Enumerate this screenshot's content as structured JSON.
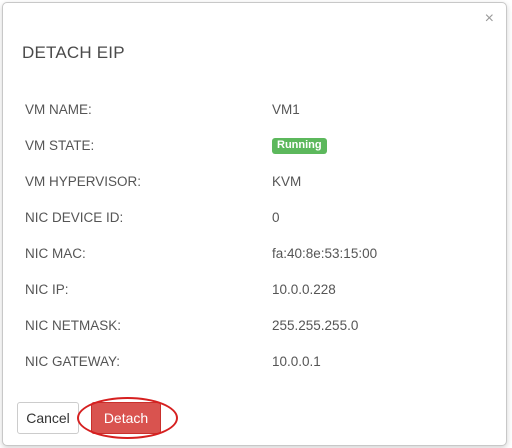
{
  "dialog": {
    "title": "DETACH EIP",
    "close_glyph": "×",
    "close_icon": "close-icon"
  },
  "fields": {
    "vm_name": {
      "label": "VM NAME:",
      "value": "VM1"
    },
    "vm_state": {
      "label": "VM STATE:",
      "value": "Running"
    },
    "vm_hypervisor": {
      "label": "VM HYPERVISOR:",
      "value": "KVM"
    },
    "nic_device_id": {
      "label": "NIC DEVICE ID:",
      "value": "0"
    },
    "nic_mac": {
      "label": "NIC MAC:",
      "value": "fa:40:8e:53:15:00"
    },
    "nic_ip": {
      "label": "NIC IP:",
      "value": "10.0.0.228"
    },
    "nic_netmask": {
      "label": "NIC NETMASK:",
      "value": "255.255.255.0"
    },
    "nic_gateway": {
      "label": "NIC GATEWAY:",
      "value": "10.0.0.1"
    }
  },
  "footer": {
    "cancel_label": "Cancel",
    "detach_label": "Detach"
  },
  "colors": {
    "running_badge": "#5cb85c",
    "danger": "#d9534f",
    "highlight": "#d62020"
  }
}
